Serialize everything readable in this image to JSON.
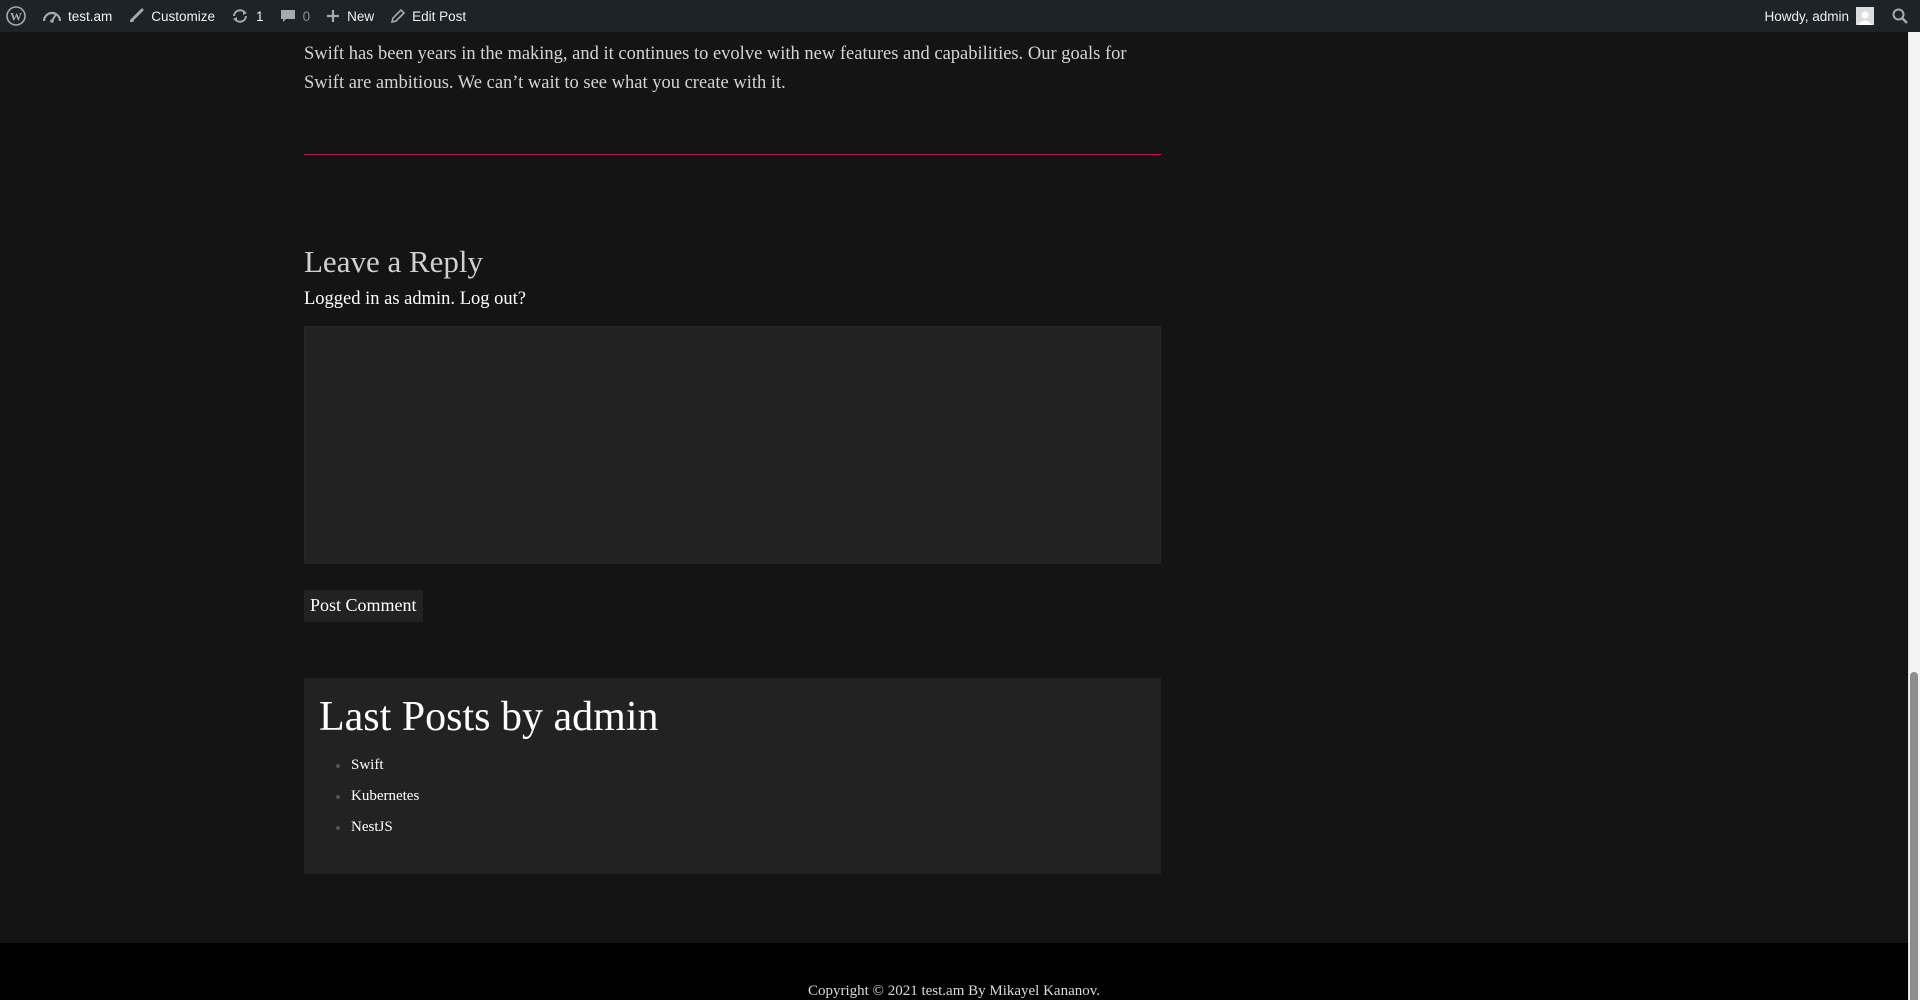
{
  "adminbar": {
    "site_name": "test.am",
    "customize": "Customize",
    "updates_count": "1",
    "comments_count": "0",
    "new_label": "New",
    "edit_post": "Edit Post",
    "howdy": "Howdy, admin"
  },
  "post": {
    "paragraph": "Swift has been years in the making, and it continues to evolve with new features and capabilities. Our goals for Swift are ambitious. We can’t wait to see what you create with it."
  },
  "reply": {
    "title": "Leave a Reply",
    "logged_in_prefix": "Logged in as admin.",
    "logout_link": "Log out?",
    "comment_value": "",
    "submit_label": "Post Comment"
  },
  "last_posts": {
    "title": "Last Posts by admin",
    "items": [
      "Swift",
      "Kubernetes",
      "NestJS"
    ]
  },
  "footer": {
    "copyright": "Copyright © 2021 test.am By Mikayel Kananov."
  },
  "colors": {
    "page_bg": "#141414",
    "panel_bg": "#222222",
    "separator": "#c2185b",
    "adminbar_bg": "#1d2327",
    "footer_bg": "#000000"
  }
}
